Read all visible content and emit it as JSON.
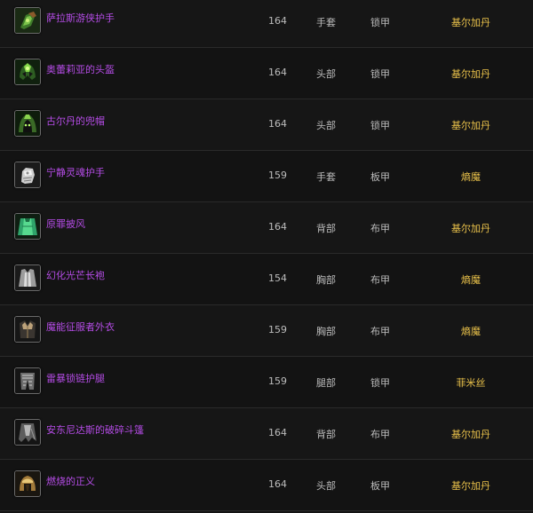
{
  "items": [
    {
      "name": "萨拉斯游侠护手",
      "level": "164",
      "slot": "手套",
      "armor": "锁甲",
      "boss": "基尔加丹",
      "icon": "green-gauntlet-icon"
    },
    {
      "name": "奥蕾莉亚的头盔",
      "level": "164",
      "slot": "头部",
      "armor": "锁甲",
      "boss": "基尔加丹",
      "icon": "green-helm-icon"
    },
    {
      "name": "古尔丹的兜帽",
      "level": "164",
      "slot": "头部",
      "armor": "锁甲",
      "boss": "基尔加丹",
      "icon": "green-hood-icon"
    },
    {
      "name": "宁静灵魂护手",
      "level": "159",
      "slot": "手套",
      "armor": "板甲",
      "boss": "熵魔",
      "icon": "plate-gauntlet-icon"
    },
    {
      "name": "原罪披风",
      "level": "164",
      "slot": "背部",
      "armor": "布甲",
      "boss": "基尔加丹",
      "icon": "green-cloak-icon"
    },
    {
      "name": "幻化光芒长袍",
      "level": "154",
      "slot": "胸部",
      "armor": "布甲",
      "boss": "熵魔",
      "icon": "silver-robe-icon"
    },
    {
      "name": "魔能征服者外衣",
      "level": "159",
      "slot": "胸部",
      "armor": "布甲",
      "boss": "熵魔",
      "icon": "dark-vest-icon"
    },
    {
      "name": "雷暴锁链护腿",
      "level": "159",
      "slot": "腿部",
      "armor": "锁甲",
      "boss": "菲米丝",
      "icon": "chain-leggings-icon"
    },
    {
      "name": "安东尼达斯的破碎斗篷",
      "level": "164",
      "slot": "背部",
      "armor": "布甲",
      "boss": "基尔加丹",
      "icon": "tattered-cloak-icon"
    },
    {
      "name": "燃烧的正义",
      "level": "164",
      "slot": "头部",
      "armor": "板甲",
      "boss": "基尔加丹",
      "icon": "golden-helm-icon"
    }
  ]
}
